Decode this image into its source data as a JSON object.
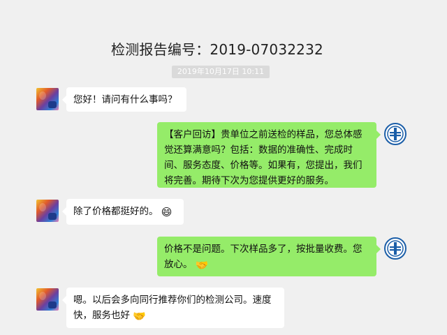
{
  "header": {
    "title": "检测报告编号：2019-07032232",
    "timestamp": "2019年10月17日 10:11"
  },
  "messages": [
    {
      "side": "left",
      "text": "您好！请问有什么事吗？"
    },
    {
      "side": "right",
      "text": "【客户回访】贵单位之前送检的样品，您总体感觉还算满意吗？包括：数据的准确性、完成时间、服务态度、价格等。如果有，您提出，我们将完善。期待下次为您提供更好的服务。"
    },
    {
      "side": "left",
      "text": "除了价格都挺好的。",
      "emoji": "😄"
    },
    {
      "side": "right",
      "text": "价格不是问题。下次样品多了，按批量收费。您放心。",
      "emoji": "🤝"
    },
    {
      "side": "left",
      "text": "嗯。以后会多向同行推荐你们的检测公司。速度快，服务也好",
      "emoji": "🤝"
    }
  ],
  "icons": {
    "left_avatar": "user-avatar-icon",
    "right_avatar": "company-logo-icon"
  },
  "colors": {
    "background": "#f0f0f0",
    "incoming_bubble": "#ffffff",
    "outgoing_bubble": "#95ec69",
    "logo_blue": "#1b5ea8"
  }
}
